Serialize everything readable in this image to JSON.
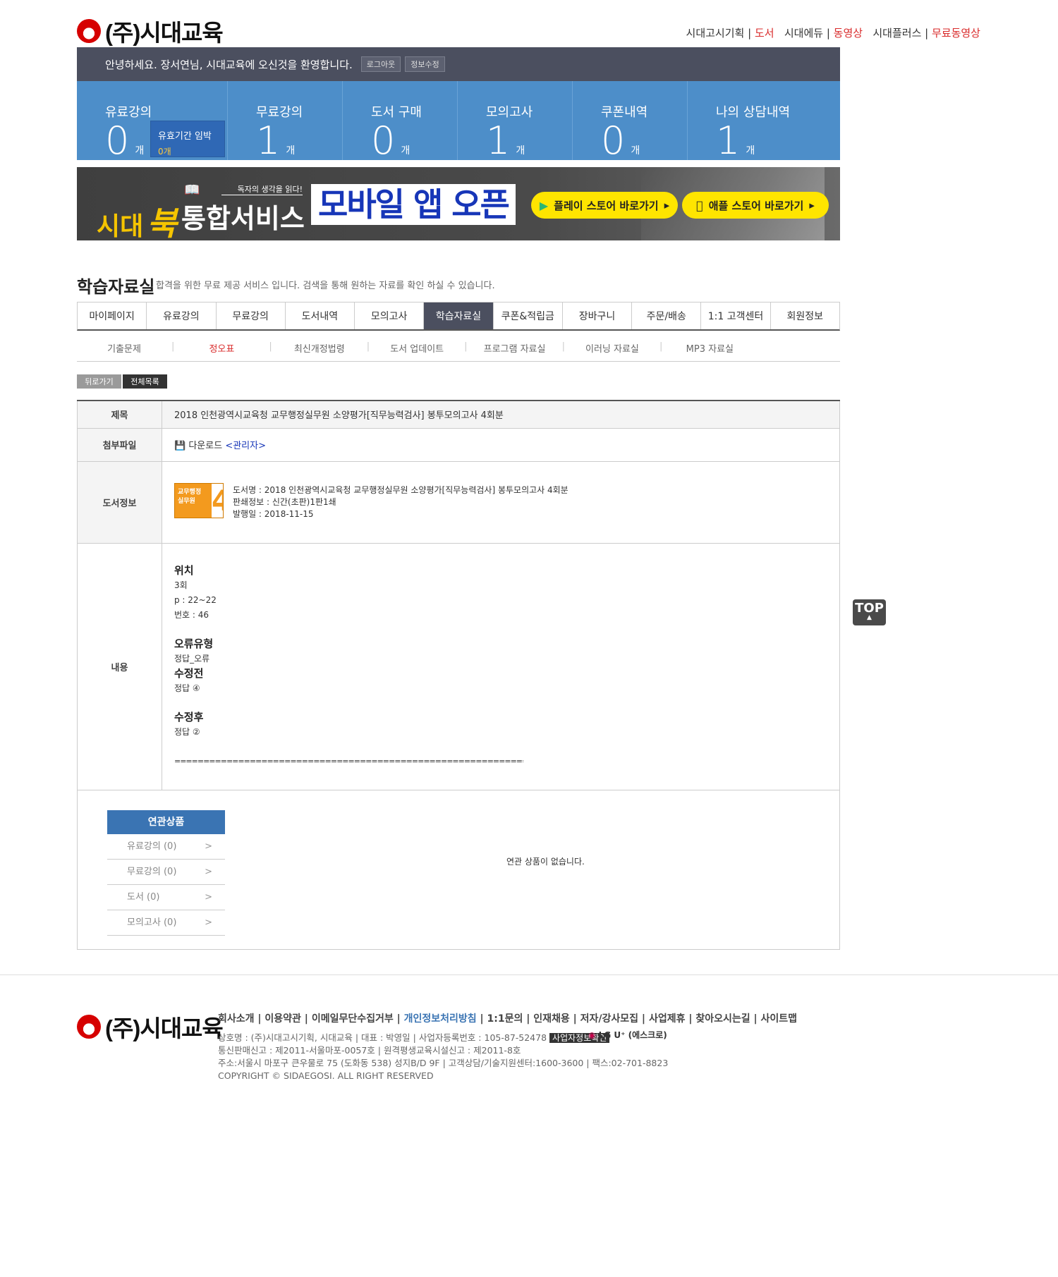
{
  "header": {
    "logo_text": "(주)시대교육",
    "links": [
      {
        "label": "시대고시기획",
        "sub": "도서"
      },
      {
        "label": "시대에듀",
        "sub": "동영상"
      },
      {
        "label": "시대플러스",
        "sub": "무료동영상"
      }
    ]
  },
  "greeting": {
    "text": "안녕하세요. 장서연님, 시대교육에 오신것을 환영합니다.",
    "logout": "로그아웃",
    "edit": "정보수정"
  },
  "stats": [
    {
      "label": "유료강의",
      "value": "0",
      "unit": "개"
    },
    {
      "label": "무료강의",
      "value": "1",
      "unit": "개"
    },
    {
      "label": "도서 구매",
      "value": "0",
      "unit": "개"
    },
    {
      "label": "모의고사",
      "value": "1",
      "unit": "개"
    },
    {
      "label": "쿠폰내역",
      "value": "0",
      "unit": "개"
    },
    {
      "label": "나의 상담내역",
      "value": "1",
      "unit": "개"
    }
  ],
  "expire_badge": {
    "label": "유효기간 임박",
    "count": "0개"
  },
  "banner": {
    "brand1": "시대",
    "brand_book": "북",
    "tagline": "독자의 생각을 읽다!",
    "service": "통합서비스",
    "mobile": "모바일 앱 오픈",
    "play_store": "플레이 스토어 바로가기",
    "app_store": "애플 스토어 바로가기"
  },
  "page": {
    "title": "학습자료실",
    "desc": "합격을 위한 무료 제공 서비스 입니다. 검색을 통해 원하는 자료를 확인 하실 수 있습니다."
  },
  "tabs": [
    "마이페이지",
    "유료강의",
    "무료강의",
    "도서내역",
    "모의고사",
    "학습자료실",
    "쿠폰&적립금",
    "장바구니",
    "주문/배송",
    "1:1 고객센터",
    "회원정보"
  ],
  "subtabs": [
    "기출문제",
    "정오표",
    "최신개정법령",
    "도서 업데이트",
    "프로그램 자료실",
    "이러닝 자료실",
    "MP3 자료실"
  ],
  "buttons": {
    "back": "뒤로가기",
    "list": "전체목록"
  },
  "detail": {
    "title_label": "제목",
    "title": "2018 인천광역시교육청 교무행정실무원 소양평가[직무능력검사] 봉투모의고사 4회분",
    "attach_label": "첨부파일",
    "attach_download": "다운로드",
    "attach_admin": "<관리자>",
    "book_label": "도서정보",
    "book_cover_text": "교무행정 실무원",
    "book_name": "도서명 : 2018 인천광역시교육청 교무행정실무원 소양평가[직무능력검사] 봉투모의고사 4회분",
    "book_print": "판쇄정보 : 신간(초판)1판1쇄",
    "book_date": "발행일 : 2018-11-15",
    "content_label": "내용",
    "position_label": "위치",
    "position_lines": [
      "3회",
      "p : 22~22",
      "번호 : 46"
    ],
    "error_type_label": "오류유형",
    "error_type": "정답_오류",
    "before_label": "수정전",
    "before": "정답 ④",
    "after_label": "수정후",
    "after": "정답 ②",
    "divider": "================================================================================"
  },
  "related": {
    "head": "연관상품",
    "items": [
      "유료강의 (0)",
      "무료강의 (0)",
      "도서 (0)",
      "모의고사 (0)"
    ],
    "empty": "연관 상품이 없습니다."
  },
  "top_button": "TOP",
  "footer": {
    "logo_text": "(주)시대교육",
    "links": [
      "회사소개",
      "이용약관",
      "이메일무단수집거부",
      "개인정보처리방침",
      "1:1문의",
      "인재채용",
      "저자/강사모집",
      "사업제휴",
      "찾아오시는길",
      "사이트맵"
    ],
    "line1": "상호명 : (주)시대고시기획, 시대교육 | 대표 : 박영일 | 사업자등록번호 : 105-87-52478",
    "biz_check": "사업자정보확인",
    "lg": "LG U⁺ (에스크로)",
    "line2": "통신판매신고 : 제2011-서울마포-0057호 | 원격평생교육시설신고 : 제2011-8호",
    "line3": "주소:서울시 마포구 큰우물로 75 (도화동 538) 성지B/D 9F | 고객상담/기술지원센터:1600-3600 | 팩스:02-701-8823",
    "copyright": "COPYRIGHT © SIDAEGOSI. ALL RIGHT RESERVED"
  },
  "colors": {
    "accent_red": "#d92b2b",
    "stat_blue": "#4d8ec9",
    "dark": "#4b4f5f",
    "yellow": "#ffe500"
  }
}
